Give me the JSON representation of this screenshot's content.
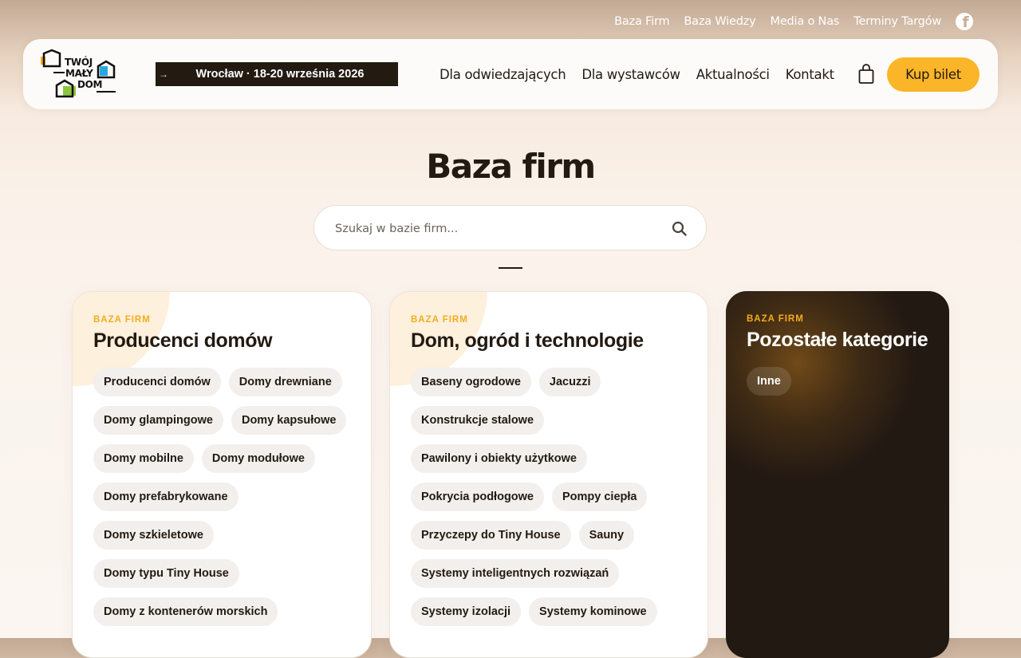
{
  "topbar": {
    "links": [
      "Baza Firm",
      "Baza Wiedzy",
      "Media o Nas",
      "Terminy Targów"
    ],
    "social_icon": "facebook-icon"
  },
  "header": {
    "logo": {
      "line1": "TWÓJ",
      "line2": "MAŁY",
      "line3": "DOM"
    },
    "banner": {
      "arrow": "→",
      "text": "Wrocław · 18-20 września 2026"
    },
    "nav": [
      "Dla odwiedzających",
      "Dla wystawców",
      "Aktualności",
      "Kontakt"
    ],
    "cart_icon": "shopping-bag-icon",
    "buy_label": "Kup bilet"
  },
  "main": {
    "title": "Baza firm",
    "search": {
      "placeholder": "Szukaj w bazie firm...",
      "value": "",
      "icon": "search-icon"
    }
  },
  "colors": {
    "accent": "#fbb528",
    "dark": "#231a12",
    "label": "#f4ac1f"
  },
  "cards": [
    {
      "label": "BAZA FIRM",
      "title": "Producenci domów",
      "tags": [
        "Producenci domów",
        "Domy drewniane",
        "Domy glampingowe",
        "Domy kapsułowe",
        "Domy mobilne",
        "Domy modułowe",
        "Domy prefabrykowane",
        "Domy szkieletowe",
        "Domy typu Tiny House",
        "Domy z kontenerów morskich"
      ]
    },
    {
      "label": "BAZA FIRM",
      "title": "Dom, ogród i technologie",
      "tags": [
        "Baseny ogrodowe",
        "Jacuzzi",
        "Konstrukcje stalowe",
        "Pawilony i obiekty użytkowe",
        "Pokrycia podłogowe",
        "Pompy ciepła",
        "Przyczepy do Tiny House",
        "Sauny",
        "Systemy inteligentnych rozwiązań",
        "Systemy izolacji",
        "Systemy kominowe"
      ]
    },
    {
      "label": "BAZA FIRM",
      "title": "Pozostałe kategorie",
      "tags": [
        "Inne"
      ]
    }
  ]
}
